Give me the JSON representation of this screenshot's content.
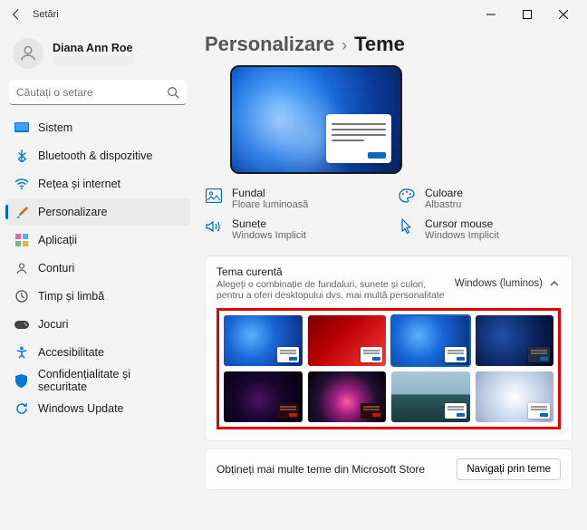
{
  "window": {
    "title": "Setări"
  },
  "user": {
    "name": "Diana Ann Roe"
  },
  "search": {
    "placeholder": "Căutați o setare"
  },
  "nav": {
    "system": "Sistem",
    "bluetooth": "Bluetooth & dispozitive",
    "network": "Rețea și internet",
    "personalization": "Personalizare",
    "apps": "Aplicații",
    "accounts": "Conturi",
    "time": "Timp și limbă",
    "gaming": "Jocuri",
    "accessibility": "Accesibilitate",
    "privacy": "Confidențialitate și securitate",
    "update": "Windows Update"
  },
  "breadcrumb": {
    "parent": "Personalizare",
    "current": "Teme"
  },
  "props": {
    "background": {
      "label": "Fundal",
      "value": "Floare luminoasă"
    },
    "color": {
      "label": "Culoare",
      "value": "Albastru"
    },
    "sounds": {
      "label": "Sunete",
      "value": "Windows Implicit"
    },
    "cursor": {
      "label": "Cursor mouse",
      "value": "Windows Implicit"
    }
  },
  "currentTheme": {
    "title": "Tema curentă",
    "subtitle": "Alegeți o combinație de fundaluri, sunete și culori, pentru a oferi desktopului dvs. mai multă personalitate",
    "value": "Windows (luminos)"
  },
  "footer": {
    "text": "Obțineți mai multe teme din Microsoft Store",
    "button": "Navigați prin teme"
  }
}
